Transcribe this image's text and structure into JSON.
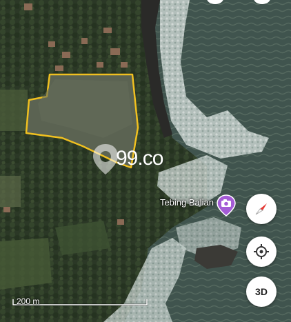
{
  "map": {
    "poi": {
      "label": "Tebing Balian",
      "icon": "camera-icon",
      "color": "#a45bd6"
    },
    "parcel_outline_color": "#f0c020",
    "scale_bar": {
      "label": "200 m"
    },
    "watermark": {
      "text": "99.co",
      "icon": "99co-pin-logo-icon"
    }
  },
  "controls": {
    "compass": {
      "icon": "compass-icon"
    },
    "my_location": {
      "icon": "crosshair-location-icon"
    },
    "toggle_3d": {
      "label": "3D"
    }
  }
}
